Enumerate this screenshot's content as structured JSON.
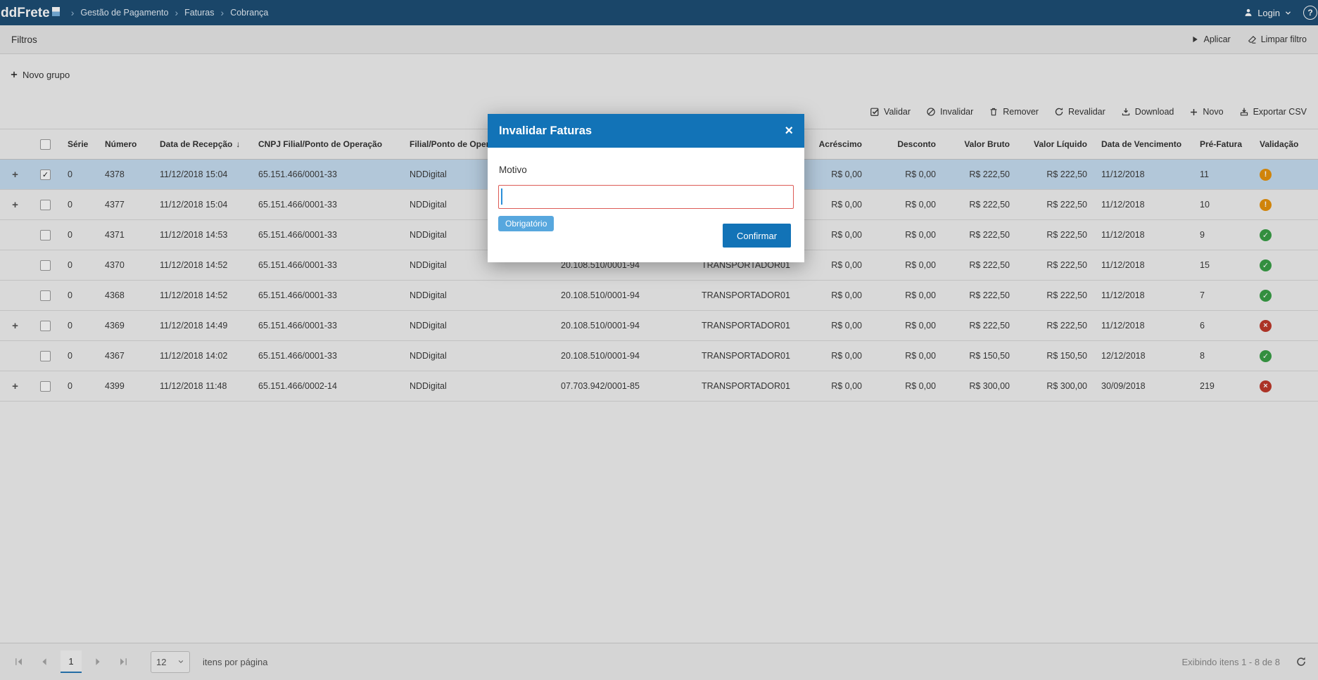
{
  "colors": {
    "navbar_bg": "#1d4e75",
    "modal_accent": "#1273b7",
    "selected_row": "#c7def2",
    "error_border": "#dd5b56",
    "required_badge_bg": "#57a7de",
    "status_warning": "#e8940c",
    "status_ok": "#39a047",
    "status_error": "#c0392b"
  },
  "icons": {
    "expand": "+",
    "check": "✓",
    "sort_desc": "↓",
    "breadcrumb_separator": "›",
    "status_glyphs": {
      "warning": "!",
      "ok": "✓",
      "error": "×"
    }
  },
  "navbar": {
    "logo": "ddFrete",
    "breadcrumb": [
      "Gestão de Pagamento",
      "Faturas",
      "Cobrança"
    ],
    "login_label": "Login",
    "help_label": "?"
  },
  "filters": {
    "title": "Filtros",
    "apply_label": "Aplicar",
    "clear_label": "Limpar filtro"
  },
  "grouping": {
    "new_group_label": "Novo grupo"
  },
  "toolbar": {
    "items": [
      {
        "id": "validar",
        "label": "Validar"
      },
      {
        "id": "invalidar",
        "label": "Invalidar"
      },
      {
        "id": "remover",
        "label": "Remover"
      },
      {
        "id": "revalidar",
        "label": "Revalidar"
      },
      {
        "id": "download",
        "label": "Download"
      },
      {
        "id": "novo",
        "label": "Novo"
      },
      {
        "id": "exportar-csv",
        "label": "Exportar CSV"
      }
    ]
  },
  "table": {
    "columns": [
      {
        "label": ""
      },
      {
        "label": ""
      },
      {
        "label": "Série"
      },
      {
        "label": "Número"
      },
      {
        "label": "Data de Recepção",
        "sorted": "desc"
      },
      {
        "label": "CNPJ Filial/Ponto de Operação"
      },
      {
        "label": "Filial/Ponto de Operação"
      },
      {
        "label": ""
      },
      {
        "label": ""
      },
      {
        "label": "Acréscimo",
        "align": "right"
      },
      {
        "label": "Desconto",
        "align": "right"
      },
      {
        "label": "Valor Bruto",
        "align": "right"
      },
      {
        "label": "Valor Líquido",
        "align": "right"
      },
      {
        "label": "Data de Vencimento"
      },
      {
        "label": "Pré-Fatura"
      },
      {
        "label": "Validação"
      }
    ],
    "rows": [
      {
        "expand": true,
        "checked": true,
        "selected": true,
        "serie": "0",
        "numero": "4378",
        "recepcao": "11/12/2018 15:04",
        "cnpj_filial": "65.151.466/0001-33",
        "filial": "NDDigital",
        "cnpj_transp": "",
        "transportador": "",
        "acrescimo": "R$ 0,00",
        "desconto": "R$ 0,00",
        "bruto": "R$ 222,50",
        "liquido": "R$ 222,50",
        "vencimento": "11/12/2018",
        "pre_fatura": "11",
        "status": "warning"
      },
      {
        "expand": true,
        "checked": false,
        "selected": false,
        "serie": "0",
        "numero": "4377",
        "recepcao": "11/12/2018 15:04",
        "cnpj_filial": "65.151.466/0001-33",
        "filial": "NDDigital",
        "cnpj_transp": "",
        "transportador": "",
        "acrescimo": "R$ 0,00",
        "desconto": "R$ 0,00",
        "bruto": "R$ 222,50",
        "liquido": "R$ 222,50",
        "vencimento": "11/12/2018",
        "pre_fatura": "10",
        "status": "warning"
      },
      {
        "expand": false,
        "checked": false,
        "selected": false,
        "serie": "0",
        "numero": "4371",
        "recepcao": "11/12/2018 14:53",
        "cnpj_filial": "65.151.466/0001-33",
        "filial": "NDDigital",
        "cnpj_transp": "",
        "transportador": "",
        "acrescimo": "R$ 0,00",
        "desconto": "R$ 0,00",
        "bruto": "R$ 222,50",
        "liquido": "R$ 222,50",
        "vencimento": "11/12/2018",
        "pre_fatura": "9",
        "status": "ok"
      },
      {
        "expand": false,
        "checked": false,
        "selected": false,
        "serie": "0",
        "numero": "4370",
        "recepcao": "11/12/2018 14:52",
        "cnpj_filial": "65.151.466/0001-33",
        "filial": "NDDigital",
        "cnpj_transp": "20.108.510/0001-94",
        "transportador": "TRANSPORTADOR01",
        "acrescimo": "R$ 0,00",
        "desconto": "R$ 0,00",
        "bruto": "R$ 222,50",
        "liquido": "R$ 222,50",
        "vencimento": "11/12/2018",
        "pre_fatura": "15",
        "status": "ok"
      },
      {
        "expand": false,
        "checked": false,
        "selected": false,
        "serie": "0",
        "numero": "4368",
        "recepcao": "11/12/2018 14:52",
        "cnpj_filial": "65.151.466/0001-33",
        "filial": "NDDigital",
        "cnpj_transp": "20.108.510/0001-94",
        "transportador": "TRANSPORTADOR01",
        "acrescimo": "R$ 0,00",
        "desconto": "R$ 0,00",
        "bruto": "R$ 222,50",
        "liquido": "R$ 222,50",
        "vencimento": "11/12/2018",
        "pre_fatura": "7",
        "status": "ok"
      },
      {
        "expand": true,
        "checked": false,
        "selected": false,
        "serie": "0",
        "numero": "4369",
        "recepcao": "11/12/2018 14:49",
        "cnpj_filial": "65.151.466/0001-33",
        "filial": "NDDigital",
        "cnpj_transp": "20.108.510/0001-94",
        "transportador": "TRANSPORTADOR01",
        "acrescimo": "R$ 0,00",
        "desconto": "R$ 0,00",
        "bruto": "R$ 222,50",
        "liquido": "R$ 222,50",
        "vencimento": "11/12/2018",
        "pre_fatura": "6",
        "status": "error"
      },
      {
        "expand": false,
        "checked": false,
        "selected": false,
        "serie": "0",
        "numero": "4367",
        "recepcao": "11/12/2018 14:02",
        "cnpj_filial": "65.151.466/0001-33",
        "filial": "NDDigital",
        "cnpj_transp": "20.108.510/0001-94",
        "transportador": "TRANSPORTADOR01",
        "acrescimo": "R$ 0,00",
        "desconto": "R$ 0,00",
        "bruto": "R$ 150,50",
        "liquido": "R$ 150,50",
        "vencimento": "12/12/2018",
        "pre_fatura": "8",
        "status": "ok"
      },
      {
        "expand": true,
        "checked": false,
        "selected": false,
        "serie": "0",
        "numero": "4399",
        "recepcao": "11/12/2018 11:48",
        "cnpj_filial": "65.151.466/0002-14",
        "filial": "NDDigital",
        "cnpj_transp": "07.703.942/0001-85",
        "transportador": "TRANSPORTADOR01",
        "acrescimo": "R$ 0,00",
        "desconto": "R$ 0,00",
        "bruto": "R$ 300,00",
        "liquido": "R$ 300,00",
        "vencimento": "30/09/2018",
        "pre_fatura": "219",
        "status": "error"
      }
    ]
  },
  "modal": {
    "title": "Invalidar Faturas",
    "close": "×",
    "motivo_label": "Motivo",
    "input_value": "",
    "required_badge": "Obrigatório",
    "confirm_label": "Confirmar"
  },
  "pager": {
    "page": "1",
    "page_size": "12",
    "items_label": "itens por página",
    "status": "Exibindo itens 1 - 8 de 8"
  }
}
